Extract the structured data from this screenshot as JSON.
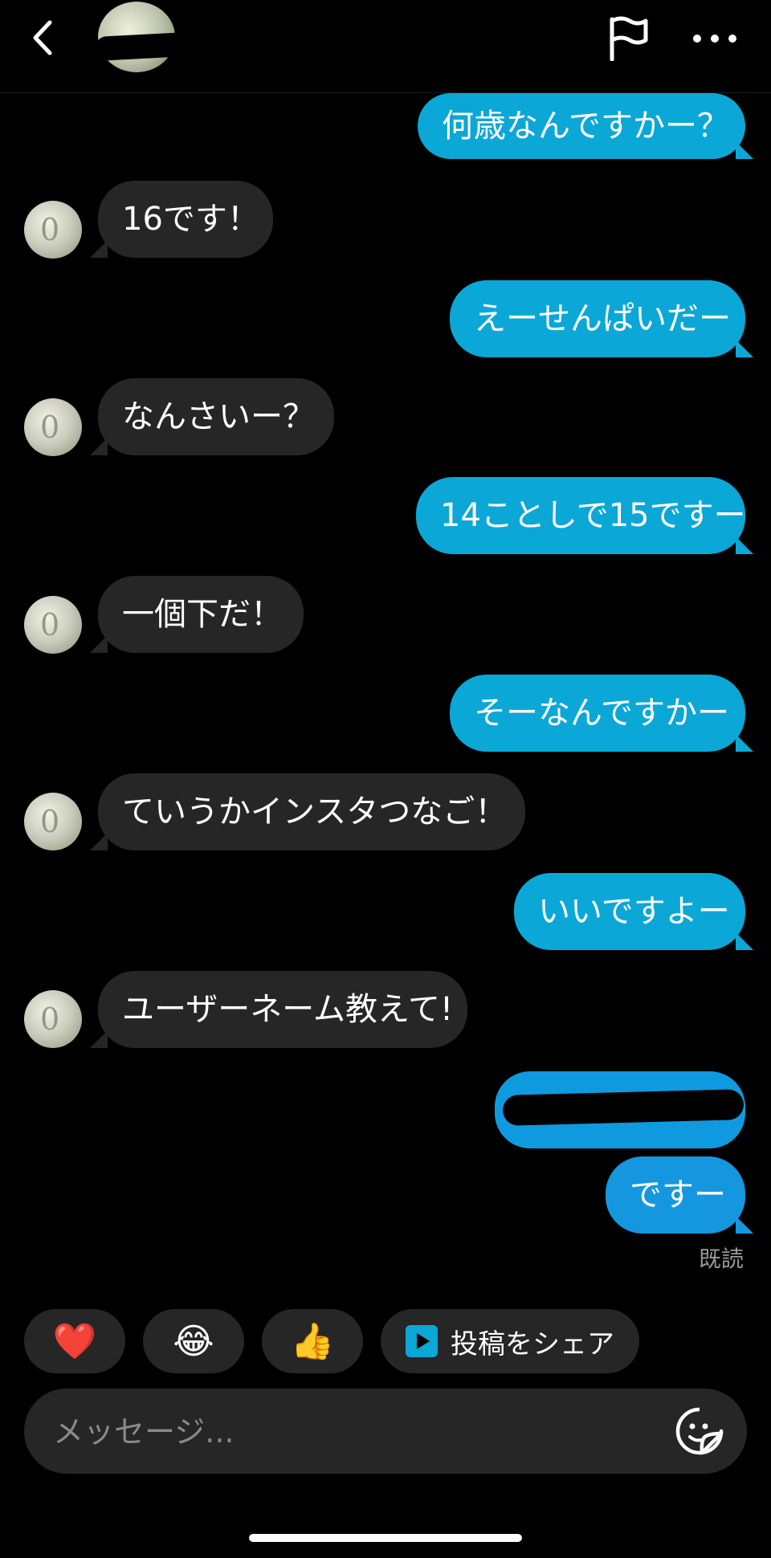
{
  "header": {
    "back_icon": "chevron-left-icon",
    "flag_icon": "flag-icon",
    "more_icon": "more-horizontal-icon"
  },
  "messages": [
    {
      "from": "me",
      "text": "何歳なんですかー？"
    },
    {
      "from": "them",
      "text": "16です！"
    },
    {
      "from": "me",
      "text": "えーせんぱいだー"
    },
    {
      "from": "them",
      "text": "なんさいー？"
    },
    {
      "from": "me",
      "text": "14ことしで15ですー"
    },
    {
      "from": "them",
      "text": "一個下だ！"
    },
    {
      "from": "me",
      "text": "そーなんですかー"
    },
    {
      "from": "them",
      "text": "ていうかインスタつなご！"
    },
    {
      "from": "me",
      "text": "いいですよー"
    },
    {
      "from": "them",
      "text": "ユーザーネーム教えて!"
    },
    {
      "from": "me",
      "text": "ですー"
    }
  ],
  "read_receipt": "既読",
  "reactions": [
    {
      "emoji": "❤️",
      "icon": "heart-icon"
    },
    {
      "emoji": "😂",
      "icon": "tears-of-joy-icon"
    },
    {
      "emoji": "👍",
      "icon": "thumbs-up-icon"
    }
  ],
  "share_post": {
    "label": "投稿をシェア",
    "icon": "play-square-icon"
  },
  "composer": {
    "placeholder": "メッセージ...",
    "sticker_icon": "sticker-icon"
  },
  "colors": {
    "sent_bubble": "#0ba7d7",
    "received_bubble": "#262626",
    "background": "#000000"
  }
}
